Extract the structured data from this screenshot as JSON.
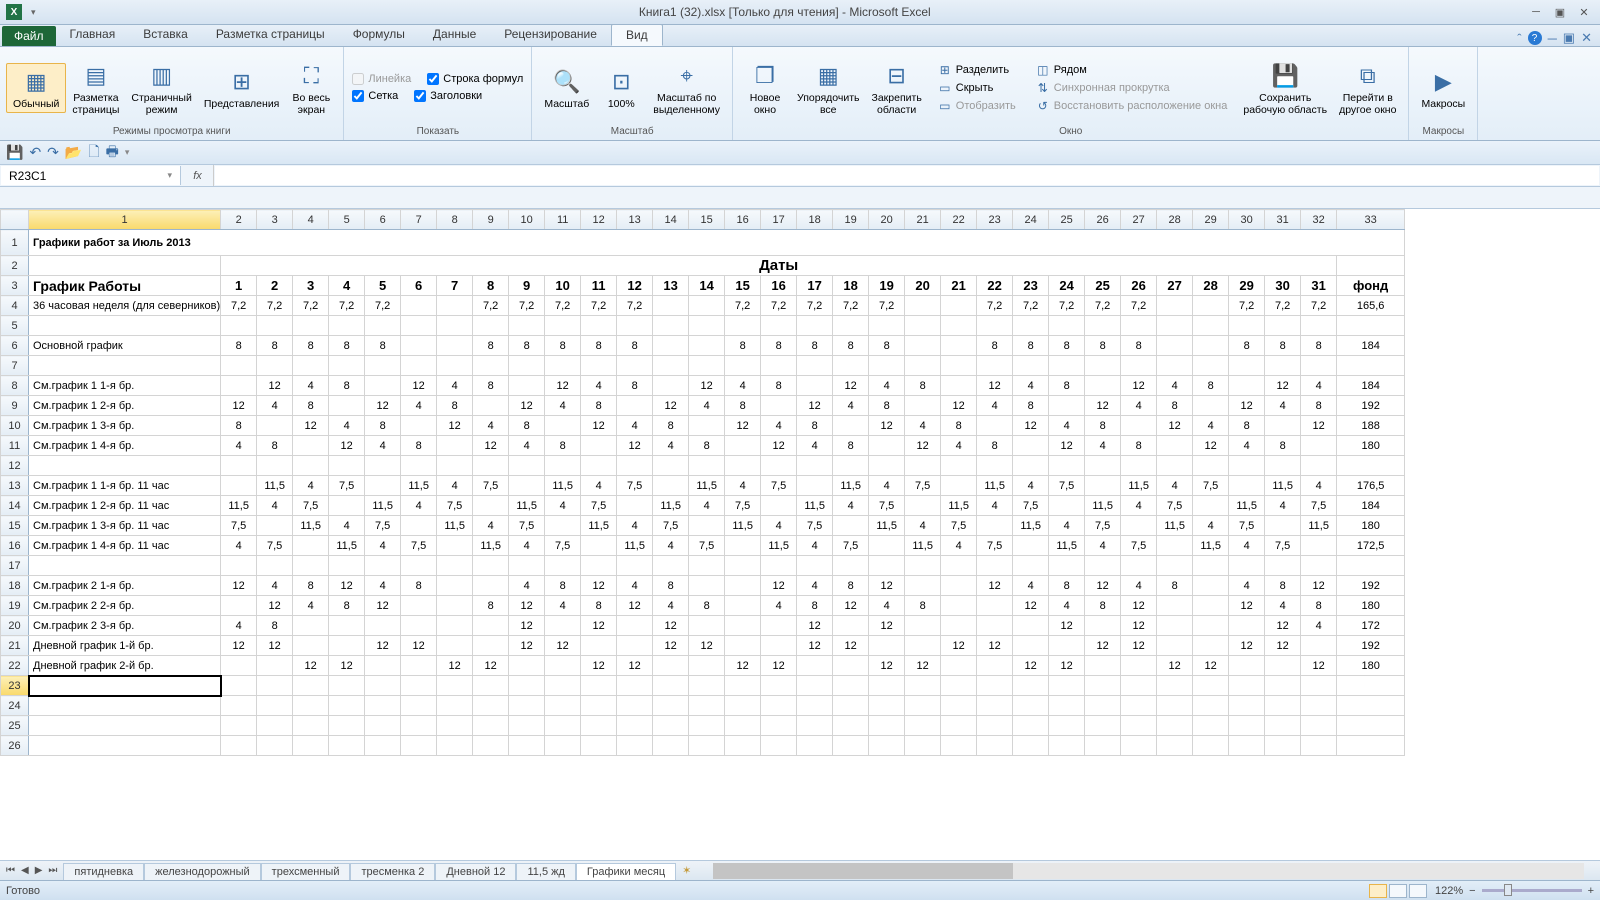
{
  "titlebar": {
    "title": "Книга1 (32).xlsx  [Только для чтения] - Microsoft Excel"
  },
  "tabs": {
    "file": "Файл",
    "items": [
      "Главная",
      "Вставка",
      "Разметка страницы",
      "Формулы",
      "Данные",
      "Рецензирование",
      "Вид"
    ],
    "active": 6
  },
  "ribbon": {
    "views": {
      "normal": "Обычный",
      "page": "Разметка\nстраницы",
      "break": "Страничный\nрежим",
      "custom": "Представления",
      "full": "Во весь\nэкран",
      "group": "Режимы просмотра книги"
    },
    "show": {
      "ruler": "Линейка",
      "formulabar": "Строка формул",
      "gridlines": "Сетка",
      "headings": "Заголовки",
      "group": "Показать"
    },
    "zoom": {
      "zoom": "Масштаб",
      "z100": "100%",
      "sel": "Масштаб по\nвыделенному",
      "group": "Масштаб"
    },
    "window": {
      "neww": "Новое\nокно",
      "arrange": "Упорядочить\nвсе",
      "freeze": "Закрепить\nобласти",
      "split": "Разделить",
      "hide": "Скрыть",
      "unhide": "Отобразить",
      "side": "Рядом",
      "sync": "Синхронная прокрутка",
      "reset": "Восстановить расположение окна",
      "save": "Сохранить\nрабочую область",
      "switch": "Перейти в\nдругое окно",
      "group": "Окно"
    },
    "macros": {
      "macros": "Макросы",
      "group": "Макросы"
    }
  },
  "namebox": "R23C1",
  "columns": 33,
  "sheet": {
    "title": "Графики работ за Июль 2013",
    "dates_hdr": "Даты",
    "schedule_hdr": "График Работы",
    "fund_hdr": "фонд",
    "days": [
      "1",
      "2",
      "3",
      "4",
      "5",
      "6",
      "7",
      "8",
      "9",
      "10",
      "11",
      "12",
      "13",
      "14",
      "15",
      "16",
      "17",
      "18",
      "19",
      "20",
      "21",
      "22",
      "23",
      "24",
      "25",
      "26",
      "27",
      "28",
      "29",
      "30",
      "31"
    ],
    "rows": [
      {
        "r": 4,
        "label": "36 часовая неделя (для северников)",
        "v": [
          "7,2",
          "7,2",
          "7,2",
          "7,2",
          "7,2",
          "",
          "",
          "7,2",
          "7,2",
          "7,2",
          "7,2",
          "7,2",
          "",
          "",
          "7,2",
          "7,2",
          "7,2",
          "7,2",
          "7,2",
          "",
          "",
          "7,2",
          "7,2",
          "7,2",
          "7,2",
          "7,2",
          "",
          "",
          "7,2",
          "7,2",
          "7,2"
        ],
        "f": "165,6"
      },
      {
        "r": 5,
        "label": "",
        "v": [],
        "f": ""
      },
      {
        "r": 6,
        "label": "Основной график",
        "v": [
          "8",
          "8",
          "8",
          "8",
          "8",
          "",
          "",
          "8",
          "8",
          "8",
          "8",
          "8",
          "",
          "",
          "8",
          "8",
          "8",
          "8",
          "8",
          "",
          "",
          "8",
          "8",
          "8",
          "8",
          "8",
          "",
          "",
          "8",
          "8",
          "8"
        ],
        "f": "184"
      },
      {
        "r": 7,
        "label": "",
        "v": [],
        "f": ""
      },
      {
        "r": 8,
        "label": "См.график 1   1-я бр.",
        "v": [
          "",
          "12",
          "4",
          "8",
          "",
          "12",
          "4",
          "8",
          "",
          "12",
          "4",
          "8",
          "",
          "12",
          "4",
          "8",
          "",
          "12",
          "4",
          "8",
          "",
          "12",
          "4",
          "8",
          "",
          "12",
          "4",
          "8",
          "",
          "12",
          "4"
        ],
        "f": "184"
      },
      {
        "r": 9,
        "label": "См.график 1   2-я бр.",
        "v": [
          "12",
          "4",
          "8",
          "",
          "12",
          "4",
          "8",
          "",
          "12",
          "4",
          "8",
          "",
          "12",
          "4",
          "8",
          "",
          "12",
          "4",
          "8",
          "",
          "12",
          "4",
          "8",
          "",
          "12",
          "4",
          "8",
          "",
          "12",
          "4",
          "8"
        ],
        "f": "192"
      },
      {
        "r": 10,
        "label": "См.график 1   3-я бр.",
        "v": [
          "8",
          "",
          "12",
          "4",
          "8",
          "",
          "12",
          "4",
          "8",
          "",
          "12",
          "4",
          "8",
          "",
          "12",
          "4",
          "8",
          "",
          "12",
          "4",
          "8",
          "",
          "12",
          "4",
          "8",
          "",
          "12",
          "4",
          "8",
          "",
          "12"
        ],
        "f": "188"
      },
      {
        "r": 11,
        "label": "См.график 1   4-я бр.",
        "v": [
          "4",
          "8",
          "",
          "12",
          "4",
          "8",
          "",
          "12",
          "4",
          "8",
          "",
          "12",
          "4",
          "8",
          "",
          "12",
          "4",
          "8",
          "",
          "12",
          "4",
          "8",
          "",
          "12",
          "4",
          "8",
          "",
          "12",
          "4",
          "8",
          ""
        ],
        "f": "180"
      },
      {
        "r": 12,
        "label": "",
        "v": [],
        "f": ""
      },
      {
        "r": 13,
        "label": "См.график 1   1-я бр. 11 час",
        "v": [
          "",
          "11,5",
          "4",
          "7,5",
          "",
          "11,5",
          "4",
          "7,5",
          "",
          "11,5",
          "4",
          "7,5",
          "",
          "11,5",
          "4",
          "7,5",
          "",
          "11,5",
          "4",
          "7,5",
          "",
          "11,5",
          "4",
          "7,5",
          "",
          "11,5",
          "4",
          "7,5",
          "",
          "11,5",
          "4"
        ],
        "f": "176,5"
      },
      {
        "r": 14,
        "label": "См.график 1   2-я бр. 11 час",
        "v": [
          "11,5",
          "4",
          "7,5",
          "",
          "11,5",
          "4",
          "7,5",
          "",
          "11,5",
          "4",
          "7,5",
          "",
          "11,5",
          "4",
          "7,5",
          "",
          "11,5",
          "4",
          "7,5",
          "",
          "11,5",
          "4",
          "7,5",
          "",
          "11,5",
          "4",
          "7,5",
          "",
          "11,5",
          "4",
          "7,5"
        ],
        "f": "184"
      },
      {
        "r": 15,
        "label": "См.график 1   3-я бр. 11 час",
        "v": [
          "7,5",
          "",
          "11,5",
          "4",
          "7,5",
          "",
          "11,5",
          "4",
          "7,5",
          "",
          "11,5",
          "4",
          "7,5",
          "",
          "11,5",
          "4",
          "7,5",
          "",
          "11,5",
          "4",
          "7,5",
          "",
          "11,5",
          "4",
          "7,5",
          "",
          "11,5",
          "4",
          "7,5",
          "",
          "11,5"
        ],
        "f": "180"
      },
      {
        "r": 16,
        "label": "См.график 1   4-я бр. 11 час",
        "v": [
          "4",
          "7,5",
          "",
          "11,5",
          "4",
          "7,5",
          "",
          "11,5",
          "4",
          "7,5",
          "",
          "11,5",
          "4",
          "7,5",
          "",
          "11,5",
          "4",
          "7,5",
          "",
          "11,5",
          "4",
          "7,5",
          "",
          "11,5",
          "4",
          "7,5",
          "",
          "11,5",
          "4",
          "7,5",
          ""
        ],
        "f": "172,5"
      },
      {
        "r": 17,
        "label": "",
        "v": [],
        "f": ""
      },
      {
        "r": 18,
        "label": "См.график 2   1-я бр.",
        "v": [
          "12",
          "4",
          "8",
          "12",
          "4",
          "8",
          "",
          "",
          "4",
          "8",
          "12",
          "4",
          "8",
          "",
          "",
          "12",
          "4",
          "8",
          "12",
          "",
          "",
          "12",
          "4",
          "8",
          "12",
          "4",
          "8",
          "",
          "4",
          "8",
          "12"
        ],
        "f": "192"
      },
      {
        "r": 19,
        "label": "См.график 2   2-я бр.",
        "v": [
          "",
          "12",
          "4",
          "8",
          "12",
          "",
          "",
          "8",
          "12",
          "4",
          "8",
          "12",
          "4",
          "8",
          "",
          "4",
          "8",
          "12",
          "4",
          "8",
          "",
          "",
          "12",
          "4",
          "8",
          "12",
          "",
          "",
          "12",
          "4",
          "8"
        ],
        "f": "180"
      },
      {
        "r": 20,
        "label": "См.график 2   3-я бр.",
        "v": [
          "4",
          "8",
          "",
          "",
          "",
          "",
          "",
          "",
          "12",
          "",
          "12",
          "",
          "12",
          "",
          "",
          "",
          "12",
          "",
          "12",
          "",
          "",
          "",
          "",
          "12",
          "",
          "12",
          "",
          "",
          "",
          "12",
          "4"
        ],
        "f": "172"
      },
      {
        "r": 21,
        "label": "Дневной график 1-й бр.",
        "v": [
          "12",
          "12",
          "",
          "",
          "12",
          "12",
          "",
          "",
          "12",
          "12",
          "",
          "",
          "12",
          "12",
          "",
          "",
          "12",
          "12",
          "",
          "",
          "12",
          "12",
          "",
          "",
          "12",
          "12",
          "",
          "",
          "12",
          "12",
          ""
        ],
        "f": "192"
      },
      {
        "r": 22,
        "label": "Дневной график 2-й бр.",
        "v": [
          "",
          "",
          "12",
          "12",
          "",
          "",
          "12",
          "12",
          "",
          "",
          "12",
          "12",
          "",
          "",
          "12",
          "12",
          "",
          "",
          "12",
          "12",
          "",
          "",
          "12",
          "12",
          "",
          "",
          "12",
          "12",
          "",
          "",
          "12"
        ],
        "f": "180"
      }
    ]
  },
  "sheettabs": {
    "items": [
      "пятидневка",
      "железнодорожный",
      "трехсменный",
      "тресменка 2",
      "Дневной 12",
      "11,5 жд",
      "Графики месяц"
    ],
    "active": 6
  },
  "status": {
    "ready": "Готово",
    "zoom": "122%"
  }
}
